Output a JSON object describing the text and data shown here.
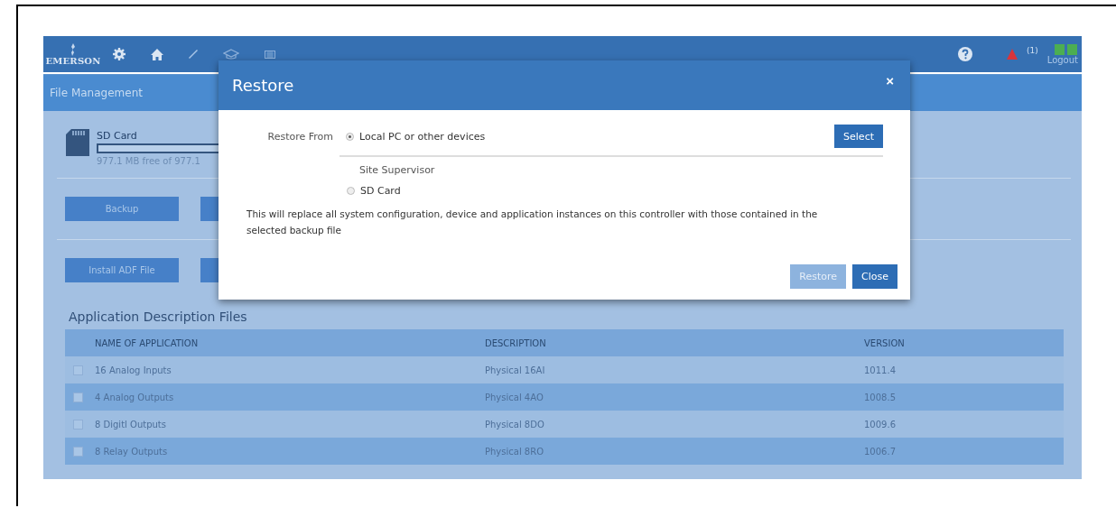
{
  "header": {
    "logo": "EMERSON",
    "alarm_count": "(1)",
    "logout": "Logout"
  },
  "page_title": "File Management",
  "storage": {
    "label": "SD Card",
    "level": 0,
    "reading": "977.1 MB free of 977.1"
  },
  "backup_button": "Backup",
  "install_button": "Install ADF File",
  "adf": {
    "title": "Application Description Files",
    "columns": [
      "NAME OF APPLICATION",
      "DESCRIPTION",
      "VERSION"
    ],
    "rows": [
      {
        "checked": false,
        "cells": [
          "16 Analog Inputs",
          "Physical 16AI",
          "1011.4"
        ]
      },
      {
        "checked": false,
        "cells": [
          "4 Analog Outputs",
          "Physical 4AO",
          "1008.5"
        ]
      },
      {
        "checked": false,
        "cells": [
          "8 Digitl Outputs",
          "Physical 8DO",
          "1009.6"
        ]
      },
      {
        "checked": false,
        "cells": [
          "8 Relay Outputs",
          "Physical 8RO",
          "1006.7"
        ]
      }
    ]
  },
  "dialog": {
    "title": "Restore",
    "close": "×",
    "restore_from_label": "Restore From",
    "sources": [
      {
        "kind": "radio",
        "label": "Local PC or other devices",
        "selected": true,
        "action": "Select"
      },
      {
        "kind": "heading",
        "label": "Site Supervisor"
      },
      {
        "kind": "radio",
        "label": "SD Card",
        "selected": false
      }
    ],
    "message": "This will replace all system configuration, device and application instances on this controller with those contained in the selected backup file",
    "buttons": [
      {
        "label": "Restore",
        "disabled": true
      },
      {
        "label": "Close",
        "disabled": false
      }
    ]
  }
}
